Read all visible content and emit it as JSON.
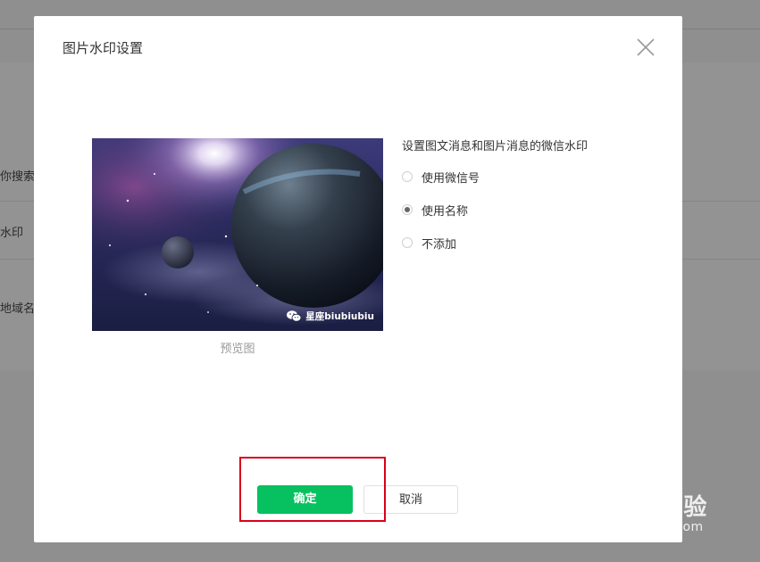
{
  "background": {
    "rows": [
      {
        "text": "你搜索到"
      },
      {
        "text": "水印"
      },
      {
        "text": "地域名层"
      }
    ]
  },
  "dialog": {
    "title": "图片水印设置",
    "close_icon": "close-icon",
    "preview": {
      "watermark_text": "星座biubiubiu",
      "watermark_icon": "wechat-icon",
      "label": "预览图"
    },
    "settings": {
      "title": "设置图文消息和图片消息的微信水印",
      "options": [
        {
          "label": "使用微信号",
          "checked": false
        },
        {
          "label": "使用名称",
          "checked": true
        },
        {
          "label": "不添加",
          "checked": false
        }
      ]
    },
    "buttons": {
      "confirm": "确定",
      "cancel": "取消"
    }
  },
  "site_watermark": {
    "brand": "Baidu经验",
    "url": "jingyan.baidu.com"
  },
  "colors": {
    "accent": "#07c160",
    "highlight": "#d9001b",
    "overlay": "#8f8f8f"
  }
}
